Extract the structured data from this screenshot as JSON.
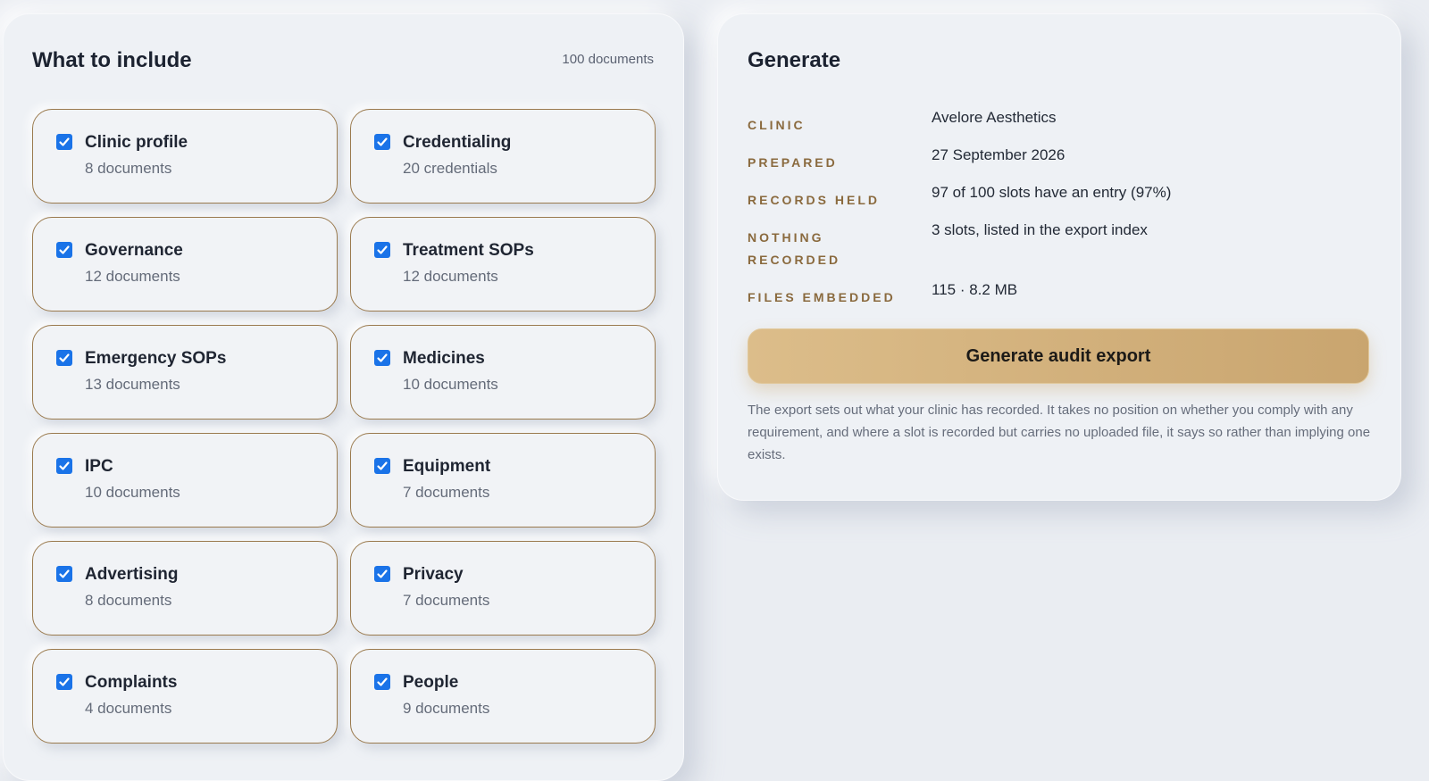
{
  "include": {
    "title": "What to include",
    "total": "100 documents",
    "categories": [
      {
        "name": "Clinic profile",
        "count": "8 documents",
        "checked": true
      },
      {
        "name": "Credentialing",
        "count": "20 credentials",
        "checked": true
      },
      {
        "name": "Governance",
        "count": "12 documents",
        "checked": true
      },
      {
        "name": "Treatment SOPs",
        "count": "12 documents",
        "checked": true
      },
      {
        "name": "Emergency SOPs",
        "count": "13 documents",
        "checked": true
      },
      {
        "name": "Medicines",
        "count": "10 documents",
        "checked": true
      },
      {
        "name": "IPC",
        "count": "10 documents",
        "checked": true
      },
      {
        "name": "Equipment",
        "count": "7 documents",
        "checked": true
      },
      {
        "name": "Advertising",
        "count": "8 documents",
        "checked": true
      },
      {
        "name": "Privacy",
        "count": "7 documents",
        "checked": true
      },
      {
        "name": "Complaints",
        "count": "4 documents",
        "checked": true
      },
      {
        "name": "People",
        "count": "9 documents",
        "checked": true
      }
    ]
  },
  "generate": {
    "title": "Generate",
    "clinic_label": "CLINIC",
    "clinic_value": "Avelore Aesthetics",
    "prepared_label": "PREPARED",
    "prepared_value": "27 September 2026",
    "records_label": "RECORDS HELD",
    "records_value": "97 of 100 slots have an entry (97%)",
    "nothing_label": "NOTHING RECORDED",
    "nothing_value": "3 slots, listed in the export index",
    "files_label": "FILES EMBEDDED",
    "files_value": "115 · 8.2 MB",
    "button_label": "Generate audit export",
    "disclaimer": "The export sets out what your clinic has recorded. It takes no position on whether you comply with any requirement, and where a slot is recorded but carries no uploaded file, it says so rather than implying one exists."
  },
  "colors": {
    "accent_gold": "#c9a56f",
    "checkbox_blue": "#1a73e8",
    "label_brown": "#8a6a3e"
  }
}
